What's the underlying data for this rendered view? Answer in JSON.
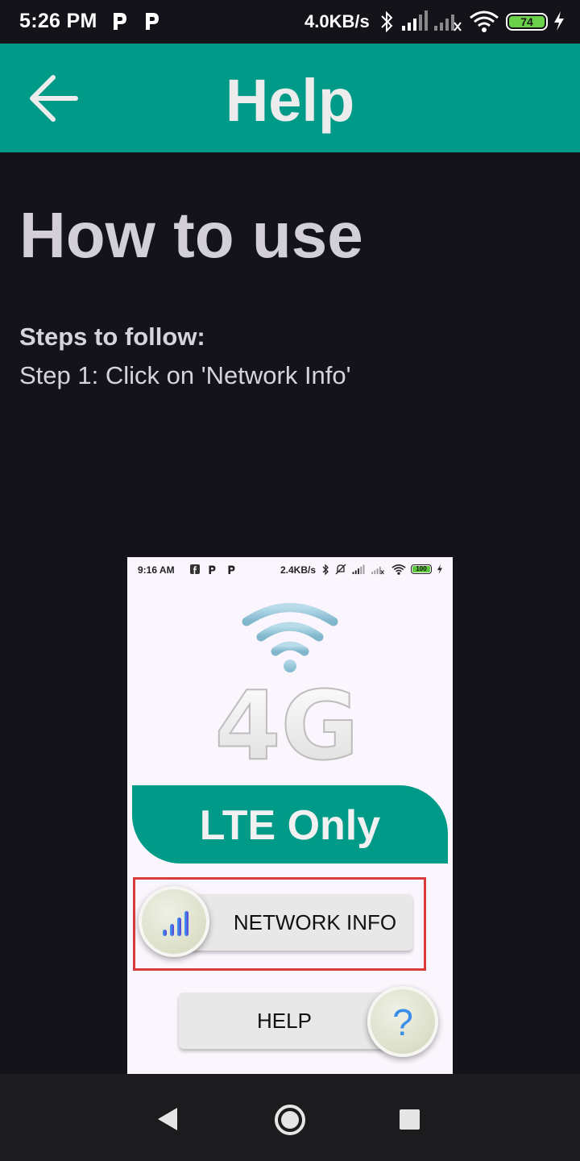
{
  "status_bar": {
    "time": "5:26 PM",
    "notification_icons": [
      "p-app-icon",
      "p-app-icon"
    ],
    "speed": "4.0KB/s",
    "icons": [
      "bluetooth-icon",
      "signal-icon",
      "signal-off-icon",
      "wifi-icon",
      "battery-icon",
      "charging-icon"
    ],
    "battery": "74"
  },
  "app_bar": {
    "title": "Help",
    "back_icon": "arrow-left-icon",
    "color": "#009a88"
  },
  "content": {
    "heading": "How to use",
    "steps_title": "Steps to follow:",
    "step_1": "Step 1: Click on 'Network Info'"
  },
  "screenshot": {
    "status_bar": {
      "time": "9:16 AM",
      "speed": "2.4KB/s",
      "battery": "100"
    },
    "logo_text": "4G",
    "banner_text": "LTE Only",
    "network_info_button": "NETWORK INFO",
    "help_button": "HELP",
    "help_icon_glyph": "?",
    "highlight_color": "#d93a3a"
  },
  "nav_bar": {
    "icons": [
      "back-triangle-icon",
      "home-circle-icon",
      "recents-square-icon"
    ]
  }
}
